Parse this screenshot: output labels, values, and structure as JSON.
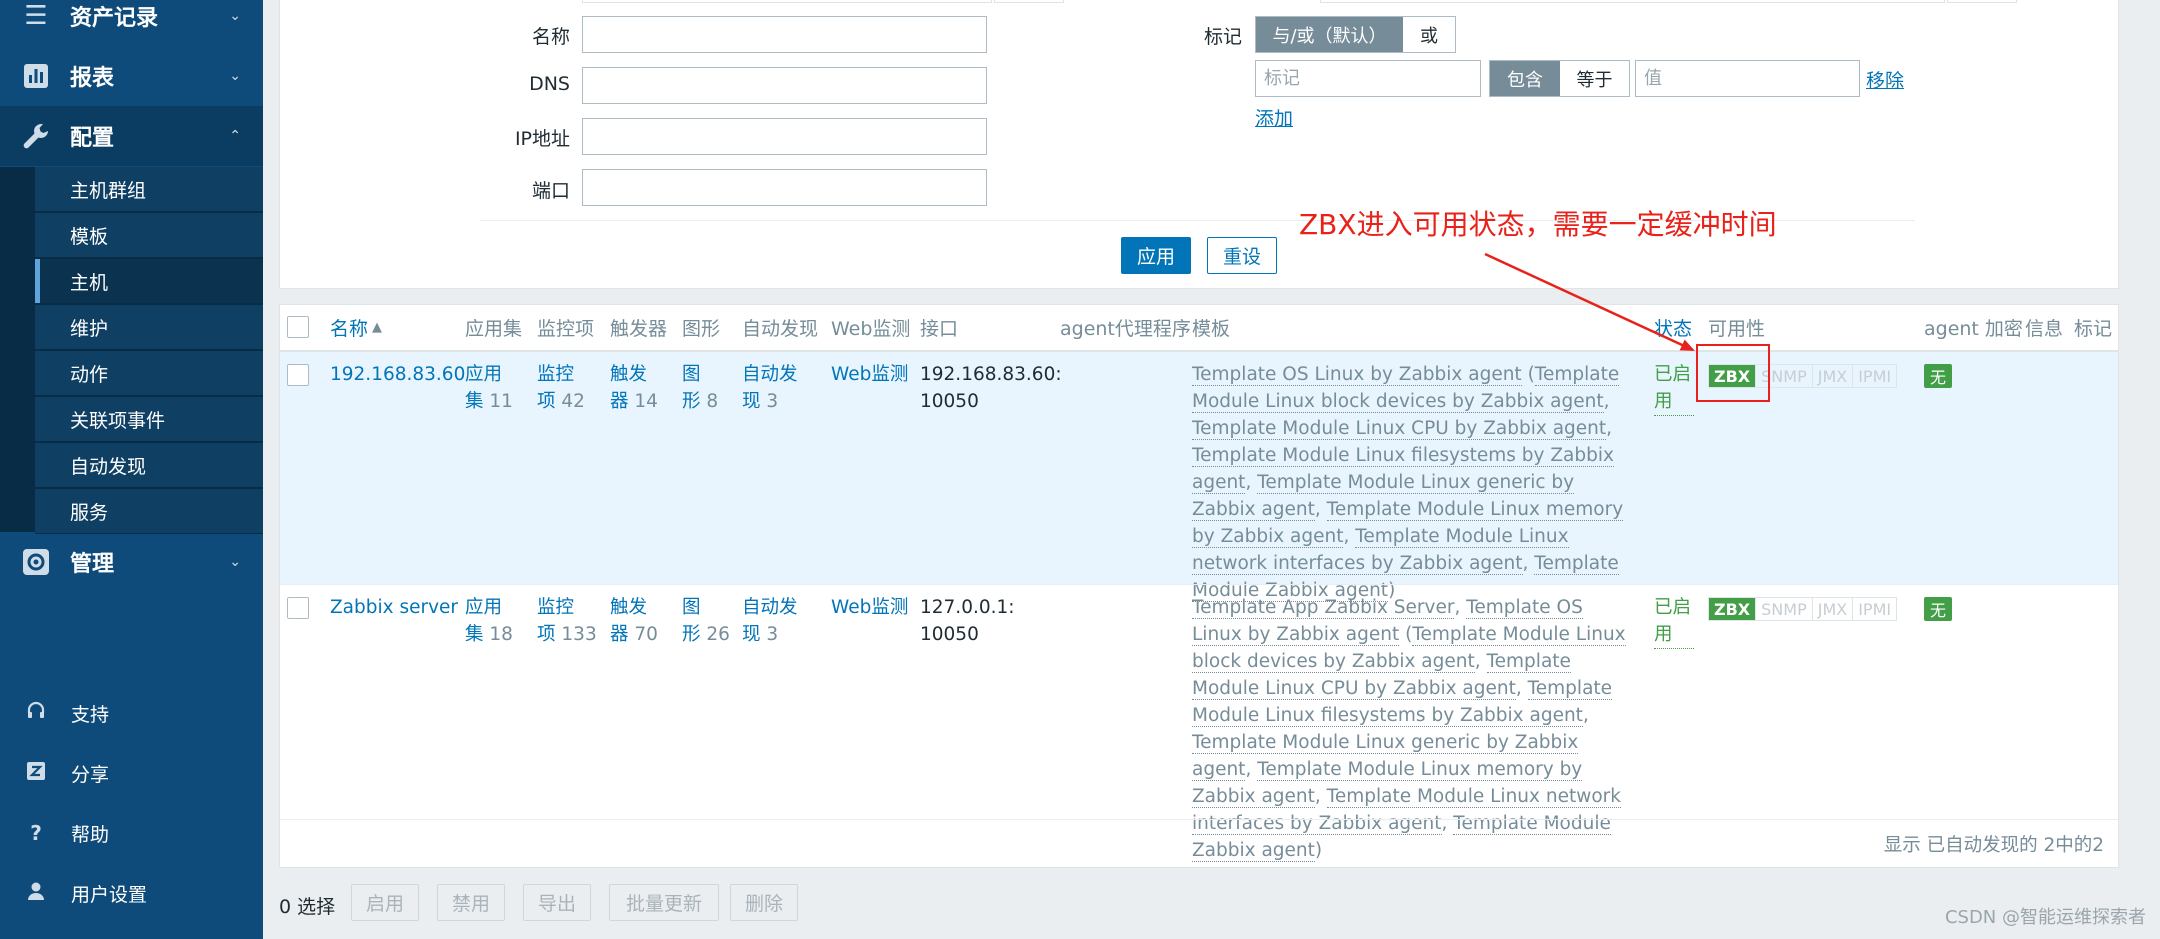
{
  "sidebar": {
    "nav": [
      {
        "label": "资产记录",
        "icon": "list-icon"
      },
      {
        "label": "报表",
        "icon": "bar-chart-icon"
      },
      {
        "label": "配置",
        "icon": "wrench-icon"
      },
      {
        "label": "管理",
        "icon": "gear-icon"
      }
    ],
    "config_submenu": [
      "主机群组",
      "模板",
      "主机",
      "维护",
      "动作",
      "关联项事件",
      "自动发现",
      "服务"
    ],
    "bottom": [
      {
        "label": "支持",
        "icon": "headset-icon"
      },
      {
        "label": "分享",
        "icon": "share-z-icon"
      },
      {
        "label": "帮助",
        "icon": "question-icon"
      },
      {
        "label": "用户设置",
        "icon": "user-icon"
      }
    ]
  },
  "filter": {
    "name_label": "名称",
    "dns_label": "DNS",
    "ip_label": "IP地址",
    "port_label": "端口",
    "tags_label": "标记",
    "tag_mode_options": [
      "与/或（默认）",
      "或"
    ],
    "tag_placeholder": "标记",
    "tag_op_options": [
      "包含",
      "等于"
    ],
    "value_placeholder": "值",
    "remove_link": "移除",
    "add_link": "添加",
    "apply_button": "应用",
    "reset_button": "重设"
  },
  "table": {
    "columns": {
      "name": "名称",
      "sort_arrow": "▲",
      "apps": "应用集",
      "items": "监控项",
      "triggers": "触发器",
      "graphs": "图形",
      "discovery": "自动发现",
      "web": "Web监测",
      "interface": "接口",
      "proxy": "agent代理程序",
      "templates": "模板",
      "status": "状态",
      "availability": "可用性",
      "encryption": "agent 加密",
      "info": "信息",
      "tags": "标记"
    },
    "rows": [
      {
        "name": "192.168.83.60",
        "apps_l1": "应用",
        "apps_l2": "集",
        "apps_count": "11",
        "items_l1": "监控",
        "items_l2": "项",
        "items_count": "42",
        "triggers_l1": "触发",
        "triggers_l2": "器",
        "triggers_count": "14",
        "graphs_l1": "图",
        "graphs_l2": "形",
        "graphs_count": "8",
        "disc_l1": "自动发",
        "disc_l2": "现",
        "disc_count": "3",
        "web": "Web监测",
        "iface_l1": "192.168.83.60:",
        "iface_l2": "10050",
        "templates": [
          "Template OS Linux by Zabbix agent",
          "Template Module Linux block devices by Zabbix agent",
          "Template Module Linux CPU by Zabbix agent",
          "Template Module Linux filesystems by Zabbix agent",
          "Template Module Linux generic by Zabbix agent",
          "Template Module Linux memory by Zabbix agent",
          "Template Module Linux network interfaces by Zabbix agent",
          "Template Module Zabbix agent"
        ],
        "status_l1": "已启",
        "status_l2": "用",
        "avail": [
          "ZBX",
          "SNMP",
          "JMX",
          "IPMI"
        ],
        "encryption": "无"
      },
      {
        "name": "Zabbix server",
        "apps_l1": "应用",
        "apps_l2": "集",
        "apps_count": "18",
        "items_l1": "监控",
        "items_l2": "项",
        "items_count": "133",
        "triggers_l1": "触发",
        "triggers_l2": "器",
        "triggers_count": "70",
        "graphs_l1": "图",
        "graphs_l2": "形",
        "graphs_count": "26",
        "disc_l1": "自动发",
        "disc_l2": "现",
        "disc_count": "3",
        "web": "Web监测",
        "iface_l1": "127.0.0.1:",
        "iface_l2": "10050",
        "templates": [
          "Template App Zabbix Server",
          "Template OS Linux by Zabbix agent",
          "Template Module Linux block devices by Zabbix agent",
          "Template Module Linux CPU by Zabbix agent",
          "Template Module Linux filesystems by Zabbix agent",
          "Template Module Linux generic by Zabbix agent",
          "Template Module Linux memory by Zabbix agent",
          "Template Module Linux network interfaces by Zabbix agent",
          "Template Module Zabbix agent"
        ],
        "status_l1": "已启",
        "status_l2": "用",
        "avail": [
          "ZBX",
          "SNMP",
          "JMX",
          "IPMI"
        ],
        "encryption": "无"
      }
    ],
    "footer": "显示 已自动发现的 2中的2"
  },
  "actions": {
    "selected": "0 选择",
    "buttons": [
      "启用",
      "禁用",
      "导出",
      "批量更新",
      "删除"
    ]
  },
  "annotation": {
    "text": "ZBX进入可用状态，需要一定缓冲时间",
    "color": "#e8221a"
  },
  "watermark": "CSDN @智能运维探索者",
  "colors": {
    "sidebar": "#0e4b7a",
    "link": "#0275b8",
    "enabled_green": "#429e47"
  }
}
